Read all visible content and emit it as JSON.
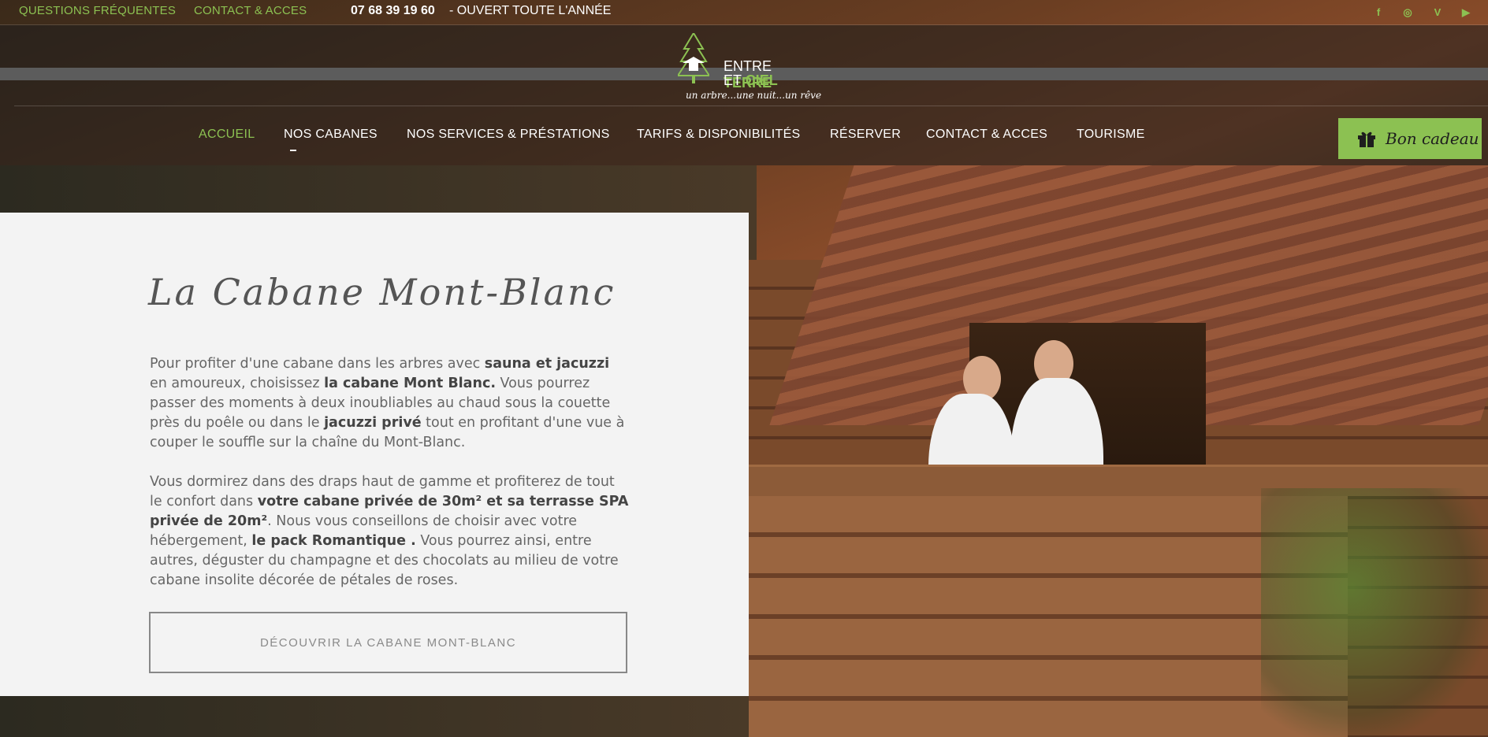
{
  "topbar": {
    "faq": "QUESTIONS FRÉQUENTES",
    "contact": "CONTACT & ACCES",
    "phone": "07 68 39 19 60",
    "open": "- OUVERT TOUTE L'ANNÉE",
    "social": [
      {
        "icon": "facebook-icon",
        "glyph": "f"
      },
      {
        "icon": "instagram-icon",
        "glyph": "◎"
      },
      {
        "icon": "vimeo-icon",
        "glyph": "V"
      },
      {
        "icon": "youtube-icon",
        "glyph": "▶"
      }
    ]
  },
  "logo": {
    "line1_plain": "ENTRE ",
    "line1_accent": "TERRE",
    "line2_plain": "ET ",
    "line2_accent": "CIEL",
    "tagline": "un arbre...une nuit...un rêve"
  },
  "nav": {
    "items": [
      "ACCUEIL",
      "NOS CABANES",
      "NOS SERVICES & PRÉSTATIONS",
      "TARIFS & DISPONIBILITÉS",
      "RÉSERVER",
      "CONTACT & ACCES",
      "TOURISME"
    ],
    "active": "ACCUEIL"
  },
  "gift": {
    "label": "Bon cadeau"
  },
  "card": {
    "title": "La Cabane Mont-Blanc",
    "para1": [
      {
        "t": "Pour profiter d'une cabane dans les arbres avec "
      },
      {
        "t": "sauna et jacuzzi",
        "b": true
      },
      {
        "t": " en amoureux, choisissez "
      },
      {
        "t": "la cabane Mont Blanc.",
        "b": true
      },
      {
        "t": " Vous pourrez passer des moments à deux inoubliables au chaud sous la couette près du poêle ou dans le "
      },
      {
        "t": "jacuzzi privé",
        "b": true
      },
      {
        "t": " tout en profitant d'une vue à couper le souffle sur la chaîne du Mont-Blanc."
      }
    ],
    "para2": [
      {
        "t": "Vous dormirez dans des draps haut de gamme et profiterez de tout le confort dans "
      },
      {
        "t": "votre cabane privée de 30m² et sa terrasse SPA privée de 20m²",
        "b": true
      },
      {
        "t": ". Nous vous conseillons de choisir avec votre hébergement, "
      },
      {
        "t": "le pack Romantique .",
        "b": true
      },
      {
        "t": " Vous pourrez ainsi, entre autres, déguster du champagne et des chocolats au milieu de votre cabane insolite décorée de pétales de roses."
      }
    ],
    "cta": "DÉCOUVRIR LA CABANE MONT-BLANC"
  },
  "colors": {
    "accent": "#8cc152",
    "card_bg": "#f3f3f3"
  }
}
